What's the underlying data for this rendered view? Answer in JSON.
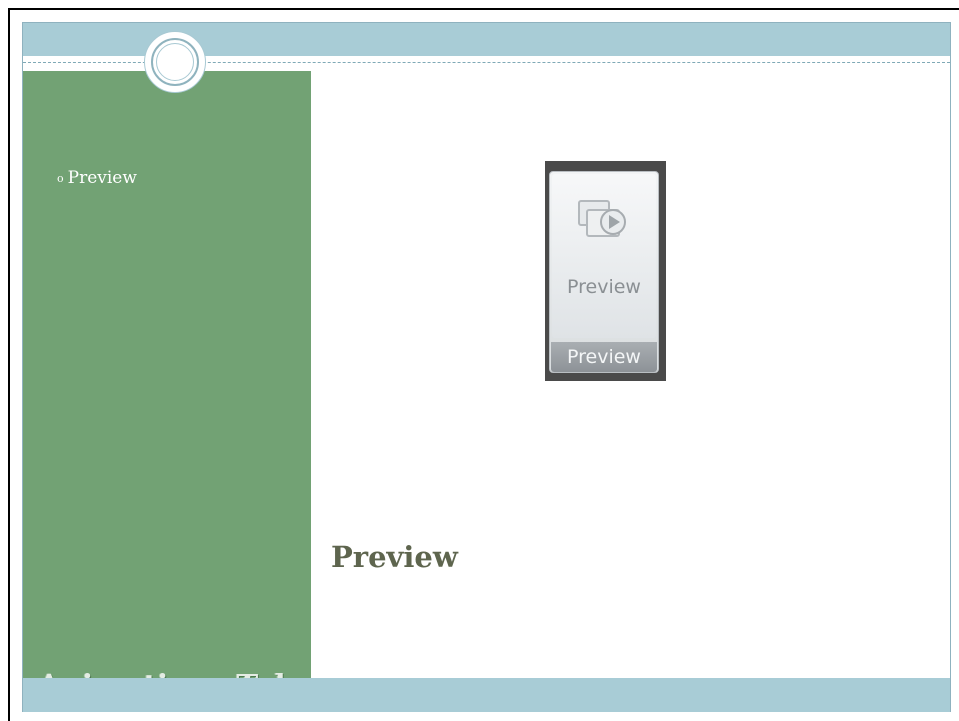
{
  "slide": {
    "bullet_items": [
      {
        "marker": "o",
        "text": "Preview"
      }
    ],
    "side_title": "Animations Tab",
    "main_title": "Preview"
  },
  "ribbon_image": {
    "button_label": "Preview",
    "group_label": "Preview",
    "icon": "preview-icon"
  },
  "colors": {
    "top_band": "#a8ccd6",
    "side_panel": "#72a274",
    "main_title": "#5e654e"
  }
}
